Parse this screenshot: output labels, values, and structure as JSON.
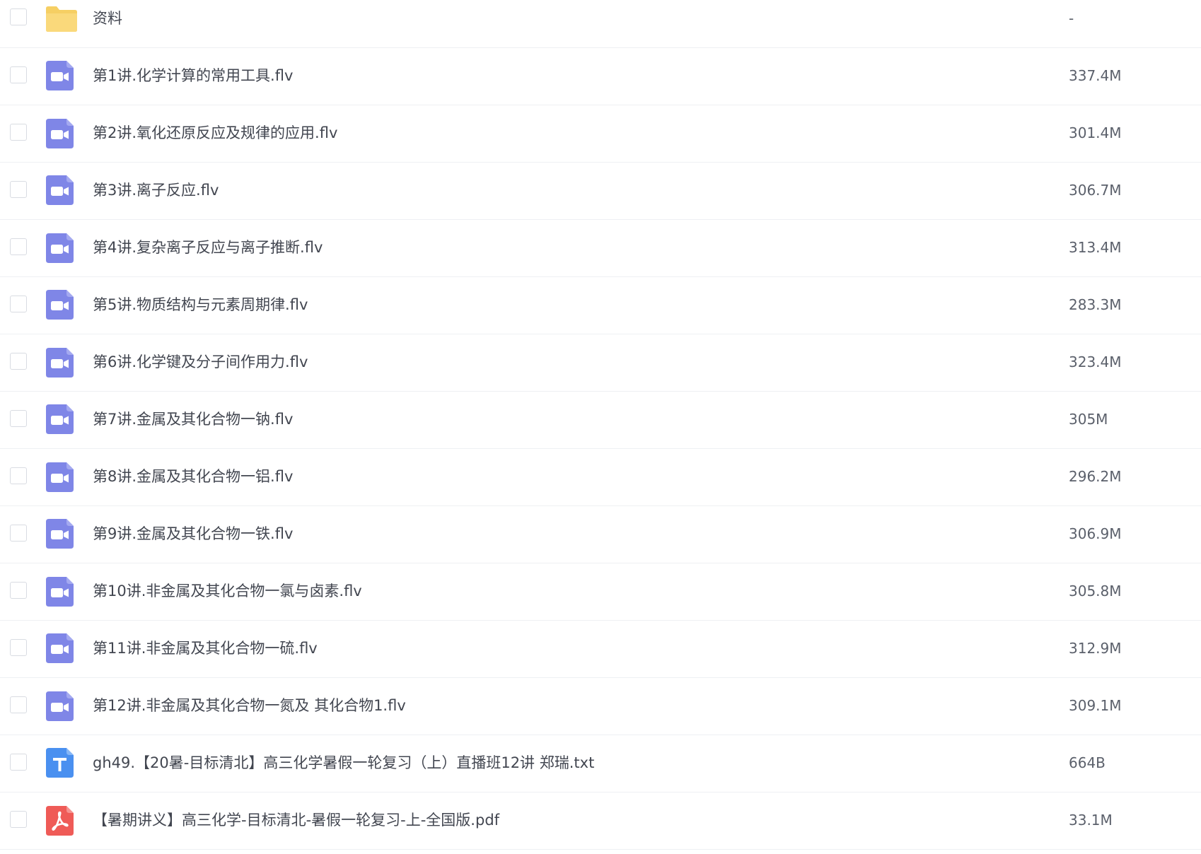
{
  "files": [
    {
      "name": "资料",
      "size": "-",
      "icon": "folder-icon",
      "type": "folder"
    },
    {
      "name": "第1讲.化学计算的常用工具.flv",
      "size": "337.4M",
      "icon": "video-file-icon",
      "type": "video"
    },
    {
      "name": "第2讲.氧化还原反应及规律的应用.flv",
      "size": "301.4M",
      "icon": "video-file-icon",
      "type": "video"
    },
    {
      "name": "第3讲.离子反应.flv",
      "size": "306.7M",
      "icon": "video-file-icon",
      "type": "video"
    },
    {
      "name": "第4讲.复杂离子反应与离子推断.flv",
      "size": "313.4M",
      "icon": "video-file-icon",
      "type": "video"
    },
    {
      "name": "第5讲.物质结构与元素周期律.flv",
      "size": "283.3M",
      "icon": "video-file-icon",
      "type": "video"
    },
    {
      "name": "第6讲.化学键及分子间作用力.flv",
      "size": "323.4M",
      "icon": "video-file-icon",
      "type": "video"
    },
    {
      "name": "第7讲.金属及其化合物一钠.flv",
      "size": "305M",
      "icon": "video-file-icon",
      "type": "video"
    },
    {
      "name": "第8讲.金属及其化合物一铝.flv",
      "size": "296.2M",
      "icon": "video-file-icon",
      "type": "video"
    },
    {
      "name": "第9讲.金属及其化合物一铁.flv",
      "size": "306.9M",
      "icon": "video-file-icon",
      "type": "video"
    },
    {
      "name": "第10讲.非金属及其化合物一氯与卤素.flv",
      "size": "305.8M",
      "icon": "video-file-icon",
      "type": "video"
    },
    {
      "name": "第11讲.非金属及其化合物一硫.flv",
      "size": "312.9M",
      "icon": "video-file-icon",
      "type": "video"
    },
    {
      "name": "第12讲.非金属及其化合物一氮及 其化合物1.flv",
      "size": "309.1M",
      "icon": "video-file-icon",
      "type": "video"
    },
    {
      "name": "gh49.【20暑-目标清北】高三化学暑假一轮复习（上）直播班12讲 郑瑞.txt",
      "size": "664B",
      "icon": "text-file-icon",
      "type": "text"
    },
    {
      "name": "【暑期讲义】高三化学-目标清北-暑假一轮复习-上-全国版.pdf",
      "size": "33.1M",
      "icon": "pdf-file-icon",
      "type": "pdf"
    }
  ],
  "colors": {
    "folder": "#f8d775",
    "video": "#7f86e7",
    "text": "#4a90f0",
    "pdf": "#ef5b57",
    "divider": "#eef0f3",
    "checkbox_border": "#d9dce2"
  }
}
